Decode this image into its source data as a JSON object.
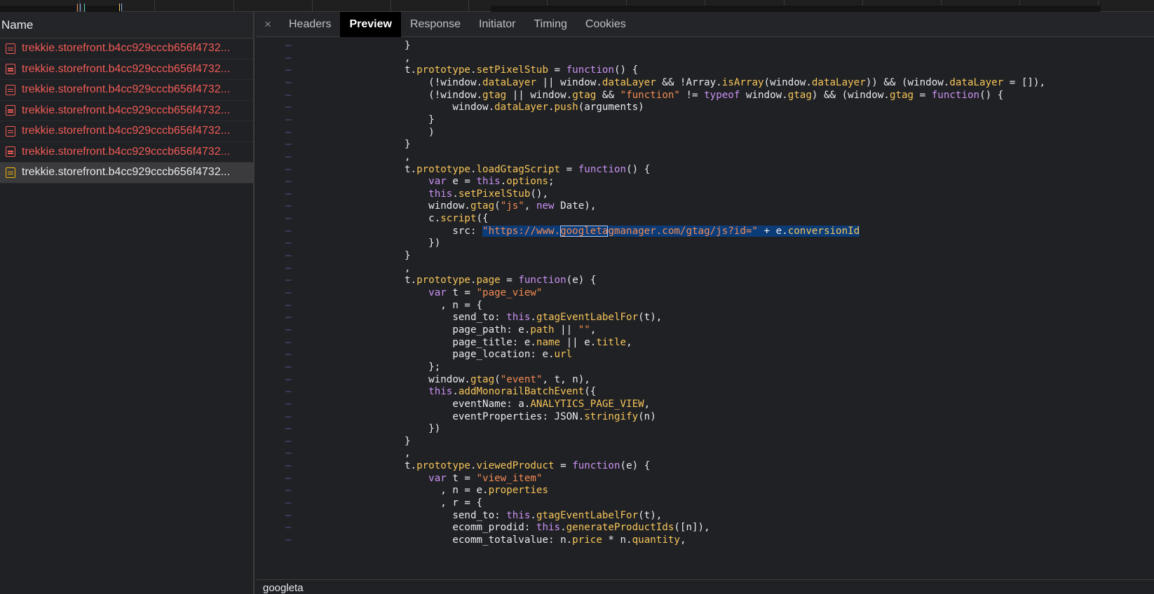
{
  "network_panel": {
    "name_column_header": "Name",
    "requests": [
      {
        "name": "trekkie.storefront.b4cc929cccb656f4732...",
        "status": "error"
      },
      {
        "name": "trekkie.storefront.b4cc929cccb656f4732...",
        "status": "error"
      },
      {
        "name": "trekkie.storefront.b4cc929cccb656f4732...",
        "status": "error"
      },
      {
        "name": "trekkie.storefront.b4cc929cccb656f4732...",
        "status": "error"
      },
      {
        "name": "trekkie.storefront.b4cc929cccb656f4732...",
        "status": "error"
      },
      {
        "name": "trekkie.storefront.b4cc929cccb656f4732...",
        "status": "error"
      },
      {
        "name": "trekkie.storefront.b4cc929cccb656f4732...",
        "status": "selected"
      }
    ]
  },
  "detail_panel": {
    "close_symbol": "×",
    "tabs": [
      "Headers",
      "Preview",
      "Response",
      "Initiator",
      "Timing",
      "Cookies"
    ],
    "active_tab": "Preview"
  },
  "code_lines": [
    "}",
    ",",
    "t.prototype.setPixelStub = function() {",
    "    (!window.dataLayer || window.dataLayer && !Array.isArray(window.dataLayer)) && (window.dataLayer = []),",
    "    (!window.gtag || window.gtag && \"function\" != typeof window.gtag) && (window.gtag = function() {",
    "        window.dataLayer.push(arguments)",
    "    }",
    "    )",
    "}",
    ",",
    "t.prototype.loadGtagScript = function() {",
    "    var e = this.options;",
    "    this.setPixelStub(),",
    "    window.gtag(\"js\", new Date),",
    "    c.script({",
    "        src: \"https://www.googletagmanager.com/gtag/js?id=\" + e.conversionId",
    "    })",
    "}",
    ",",
    "t.prototype.page = function(e) {",
    "    var t = \"page_view\"",
    "      , n = {",
    "        send_to: this.gtagEventLabelFor(t),",
    "        page_path: e.path || \"\",",
    "        page_title: e.name || e.title,",
    "        page_location: e.url",
    "    };",
    "    window.gtag(\"event\", t, n),",
    "    this.addMonorailBatchEvent({",
    "        eventName: a.ANALYTICS_PAGE_VIEW,",
    "        eventProperties: JSON.stringify(n)",
    "    })",
    "}",
    ",",
    "t.prototype.viewedProduct = function(e) {",
    "    var t = \"view_item\"",
    "      , n = e.properties",
    "      , r = {",
    "        send_to: this.gtagEventLabelFor(t),",
    "        ecomm_prodid: this.generateProductIds([n]),",
    "        ecomm_totalvalue: n.price * n.quantity,"
  ],
  "gutter_marker": "–",
  "search": {
    "value": "googleta",
    "highlight_line": 15,
    "highlight_text": "\"https://www.googletagmanager.com/gtag/js?id=\" + e.conversionId"
  },
  "colors": {
    "keyword": "#c991f2",
    "string": "#f28b54",
    "property": "#f6c55a",
    "error_request": "#f05b57",
    "search_highlight": "#0c3c78"
  }
}
